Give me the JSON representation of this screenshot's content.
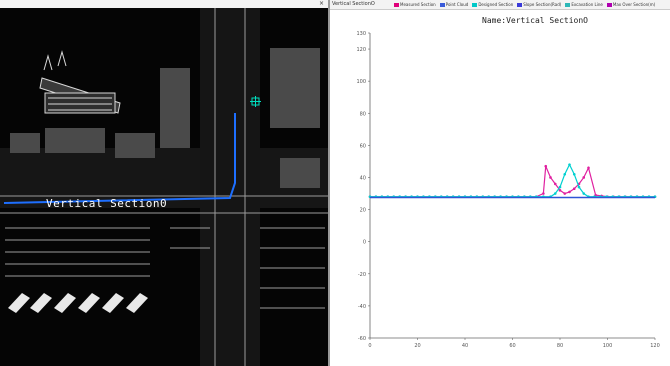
{
  "map_view": {
    "section_label": "Vertical Section0"
  },
  "chart_window": {
    "tab_title": "Vertical SectionO",
    "chart_title": "Name:Vertical SectionO",
    "legend": [
      {
        "label": "Measured Section",
        "color": "#e0007a"
      },
      {
        "label": "Point Cloud",
        "color": "#3a5bd9"
      },
      {
        "label": "Designed Section",
        "color": "#00c8c8"
      },
      {
        "label": "Slope Section(Rad)",
        "color": "#3a3ad9"
      },
      {
        "label": "Excavation Line",
        "color": "#2db8b8"
      },
      {
        "label": "Max Over Section(m)",
        "color": "#b000b0"
      }
    ],
    "chart_data": {
      "type": "line",
      "x_ticks": [
        "0",
        "20",
        "40",
        "60",
        "80",
        "100",
        "120"
      ],
      "y_ticks": [
        "-60",
        "-40",
        "-20",
        "0",
        "20",
        "40",
        "60",
        "80",
        "100",
        "120",
        "130"
      ],
      "xlim": [
        0,
        120
      ],
      "ylim": [
        -60,
        130
      ],
      "series": [
        {
          "name": "Measured Section",
          "color": "#e020a0",
          "marker": "dot",
          "x": [
            0,
            10,
            20,
            30,
            40,
            50,
            60,
            70,
            73,
            74,
            76,
            78,
            80,
            82,
            84,
            86,
            88,
            90,
            92,
            95,
            100,
            110,
            120
          ],
          "y": [
            28,
            28,
            28,
            28,
            28,
            28,
            28,
            28,
            30,
            47,
            40,
            36,
            32,
            30,
            31,
            33,
            36,
            40,
            46,
            29,
            28,
            28,
            28
          ]
        },
        {
          "name": "Designed Section",
          "color": "#00d0d0",
          "marker": "dot",
          "x": [
            0,
            70,
            76,
            78,
            80,
            82,
            84,
            86,
            88,
            90,
            92,
            120
          ],
          "y": [
            28,
            28,
            28,
            30,
            34,
            42,
            48,
            42,
            34,
            30,
            28,
            28
          ]
        },
        {
          "name": "Point Cloud",
          "color": "#2f55d6",
          "marker": "line",
          "x": [
            0,
            120
          ],
          "y": [
            27.5,
            27.5
          ]
        }
      ]
    }
  }
}
